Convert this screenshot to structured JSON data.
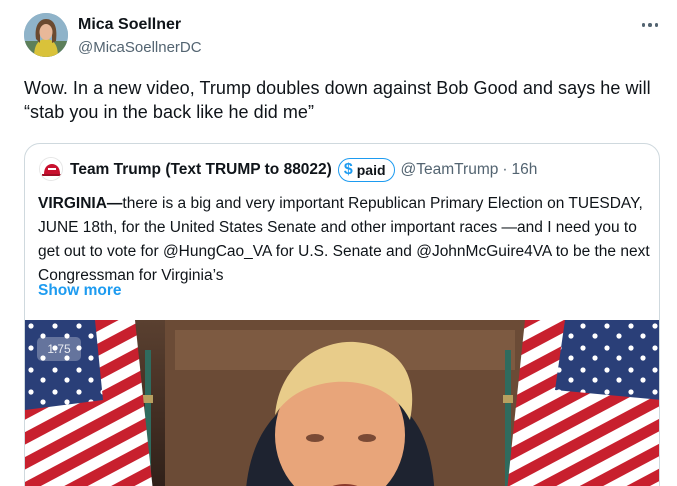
{
  "post": {
    "author_name": "Mica Soellner",
    "author_handle": "@MicaSoellnerDC",
    "text": "Wow. In a new video, Trump doubles down against Bob Good and says he will “stab you in the back like he did me”",
    "more_icon": "more-horizontal-icon"
  },
  "quote": {
    "name": "Team Trump (Text TRUMP to 88022)",
    "badge_symbol": "$",
    "badge_label": "paid",
    "handle": "@TeamTrump",
    "separator": "·",
    "time": "16h",
    "text_lead": "VIRGINIA—",
    "text_body": "there is a big and very important Republican Primary Election on TUESDAY, JUNE 18th, for the United States Senate and other important races —and I need you to get out to vote for @HungCao_VA  for U.S. Senate and @JohnMcGuire4VA to be the next Congressman for Virginia’s",
    "show_more": "Show more",
    "media": {
      "speed_label": "1.75"
    }
  },
  "colors": {
    "accent": "#1d9bf0",
    "text_primary": "#0f1419",
    "text_secondary": "#536471",
    "border": "#cfd9de"
  }
}
